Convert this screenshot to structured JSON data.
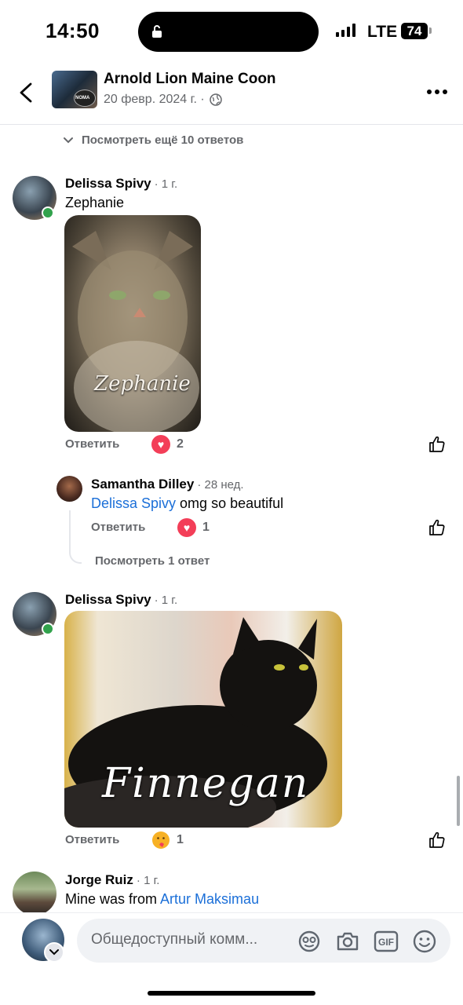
{
  "status_bar": {
    "time": "14:50",
    "network": "LTE",
    "battery": "74"
  },
  "header": {
    "title": "Arnold Lion Maine Coon",
    "date": "20 февр. 2024 г. ·",
    "thumb_text": "NOMA"
  },
  "view_more_top": "Посмотреть ещё 10 ответов",
  "comments": [
    {
      "author": "Delissa Spivy",
      "time": "· 1 г.",
      "text": "Zephanie",
      "image_caption": "Zephanie",
      "reply_label": "Ответить",
      "reaction_count": "2"
    },
    {
      "author": "Samantha Dilley",
      "time": "· 28 нед.",
      "mention": "Delissa Spivy",
      "text": " omg so beautiful",
      "reply_label": "Ответить",
      "reaction_count": "1",
      "view_replies": "Посмотреть 1 ответ"
    },
    {
      "author": "Delissa Spivy",
      "time": "· 1 г.",
      "image_caption": "Finnegan",
      "reply_label": "Ответить",
      "reaction_count": "1"
    },
    {
      "author": "Jorge Ruiz",
      "time": "· 1 г.",
      "text": "Mine was from ",
      "mention": "Artur Maksimau"
    }
  ],
  "composer": {
    "placeholder": "Общедоступный комм..."
  },
  "colors": {
    "accent": "#1b6fd8",
    "heart": "#f33e58",
    "online": "#31a24c",
    "muted": "#65676b"
  },
  "icons": [
    "back-icon",
    "globe-icon",
    "more-icon",
    "chevron-down-icon",
    "heart-reaction-icon",
    "care-reaction-icon",
    "like-icon",
    "avatar-icon",
    "camera-icon",
    "gif-icon",
    "emoji-icon"
  ]
}
